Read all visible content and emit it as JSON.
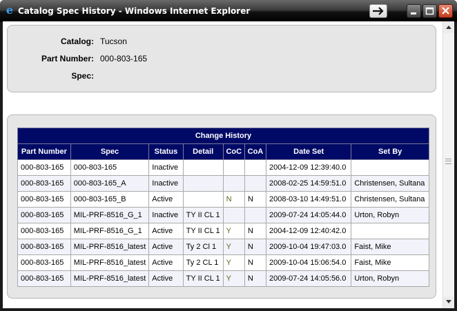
{
  "window": {
    "title": "Catalog Spec History - Windows Internet Explorer",
    "app_icon": "internet-explorer-icon"
  },
  "info": {
    "catalog_label": "Catalog:",
    "catalog_value": "Tucson",
    "part_label": "Part Number:",
    "part_value": "000-803-165",
    "spec_label": "Spec:",
    "spec_value": ""
  },
  "history": {
    "caption": "Change History",
    "columns": [
      "Part Number",
      "Spec",
      "Status",
      "Detail",
      "CoC",
      "CoA",
      "Date Set",
      "Set By"
    ],
    "rows": [
      [
        "000-803-165",
        "000-803-165",
        "Inactive",
        "",
        "",
        "",
        "2004-12-09 12:39:40.0",
        ""
      ],
      [
        "000-803-165",
        "000-803-165_A",
        "Inactive",
        "",
        "",
        "",
        "2008-02-25 14:59:51.0",
        "Christensen, Sultana"
      ],
      [
        "000-803-165",
        "000-803-165_B",
        "Active",
        "",
        "N",
        "N",
        "2008-03-10 14:49:51.0",
        "Christensen, Sultana"
      ],
      [
        "000-803-165",
        "MIL-PRF-8516_G_1",
        "Inactive",
        "TY II CL 1",
        "",
        "",
        "2009-07-24 14:05:44.0",
        "Urton, Robyn"
      ],
      [
        "000-803-165",
        "MIL-PRF-8516_G_1",
        "Active",
        "TY II CL 1",
        "Y",
        "N",
        "2004-12-09 12:40:42.0",
        ""
      ],
      [
        "000-803-165",
        "MIL-PRF-8516_latest",
        "Active",
        "Ty 2 Cl 1",
        "Y",
        "N",
        "2009-10-04 19:47:03.0",
        "Faist, Mike"
      ],
      [
        "000-803-165",
        "MIL-PRF-8516_latest",
        "Active",
        "Ty 2 CL 1",
        "Y",
        "N",
        "2009-10-04 15:06:54.0",
        "Faist, Mike"
      ],
      [
        "000-803-165",
        "MIL-PRF-8516_latest",
        "Active",
        "TY II CL 1",
        "Y",
        "N",
        "2009-07-24 14:05:56.0",
        "Urton, Robyn"
      ]
    ]
  },
  "colors": {
    "header_bg": "#000a66",
    "panel_bg": "#e6e6e6",
    "close_button": "#c33a1c"
  }
}
